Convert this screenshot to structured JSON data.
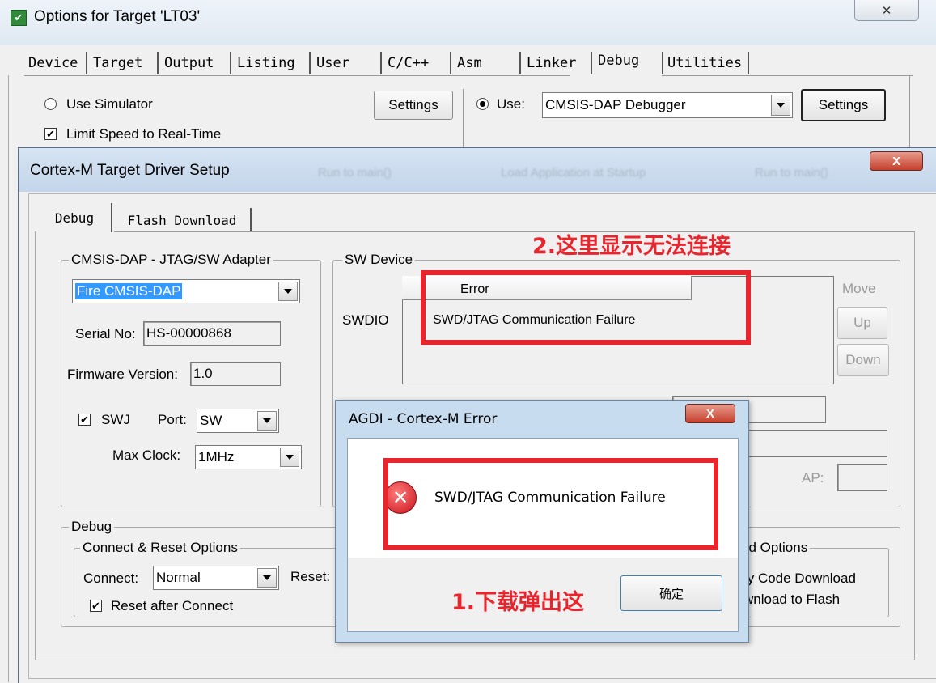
{
  "main_window": {
    "title": "Options for Target 'LT03'",
    "close_glyph": "✕",
    "tabs": [
      "Device",
      "Target",
      "Output",
      "Listing",
      "User",
      "C/C++",
      "Asm",
      "Linker",
      "Debug",
      "Utilities"
    ],
    "active_tab": "Debug",
    "use_simulator_label": "Use Simulator",
    "settings_label": "Settings",
    "limit_speed_label": "Limit Speed to Real-Time",
    "use_label": "Use:",
    "debugger": "CMSIS-DAP Debugger"
  },
  "driver_setup": {
    "title": "Cortex-M Target Driver Setup",
    "ghost_options": [
      "Run to main()",
      "Load Application at Startup",
      "Run to main()"
    ],
    "tabs": [
      "Debug",
      "Flash Download"
    ],
    "adapter": {
      "group_label": "CMSIS-DAP - JTAG/SW Adapter",
      "device": "Fire CMSIS-DAP",
      "serial_label": "Serial No:",
      "serial_value": "HS-00000868",
      "firmware_label": "Firmware Version:",
      "firmware_value": "1.0",
      "swj_label": "SWJ",
      "port_label": "Port:",
      "port_value": "SW",
      "max_clock_label": "Max Clock:",
      "max_clock_value": "1MHz"
    },
    "sw_device": {
      "group_label": "SW Device",
      "swdio_label": "SWDIO",
      "column_header": "Error",
      "row_text": "SWD/JTAG Communication Failure",
      "move_label": "Move",
      "up_label": "Up",
      "down_label": "Down",
      "ap_label": "AP:"
    },
    "debug_group": {
      "label": "Debug",
      "connect_reset_label": "Connect & Reset Options",
      "connect_label": "Connect:",
      "connect_value": "Normal",
      "reset_label": "Reset:",
      "reset_after_connect_label": "Reset after Connect",
      "download_options_label": "ad Options",
      "verify_label": "fy Code Download",
      "download_flash_label": "wnload to Flash"
    }
  },
  "error_dialog": {
    "title": "AGDI - Cortex-M Error",
    "message": "SWD/JTAG Communication Failure",
    "ok_label": "确定",
    "close_glyph": "X"
  },
  "annotations": {
    "note_connect": "2.这里显示无法连接",
    "note_download": "1.下载弹出这",
    "color": "#e8252d"
  }
}
